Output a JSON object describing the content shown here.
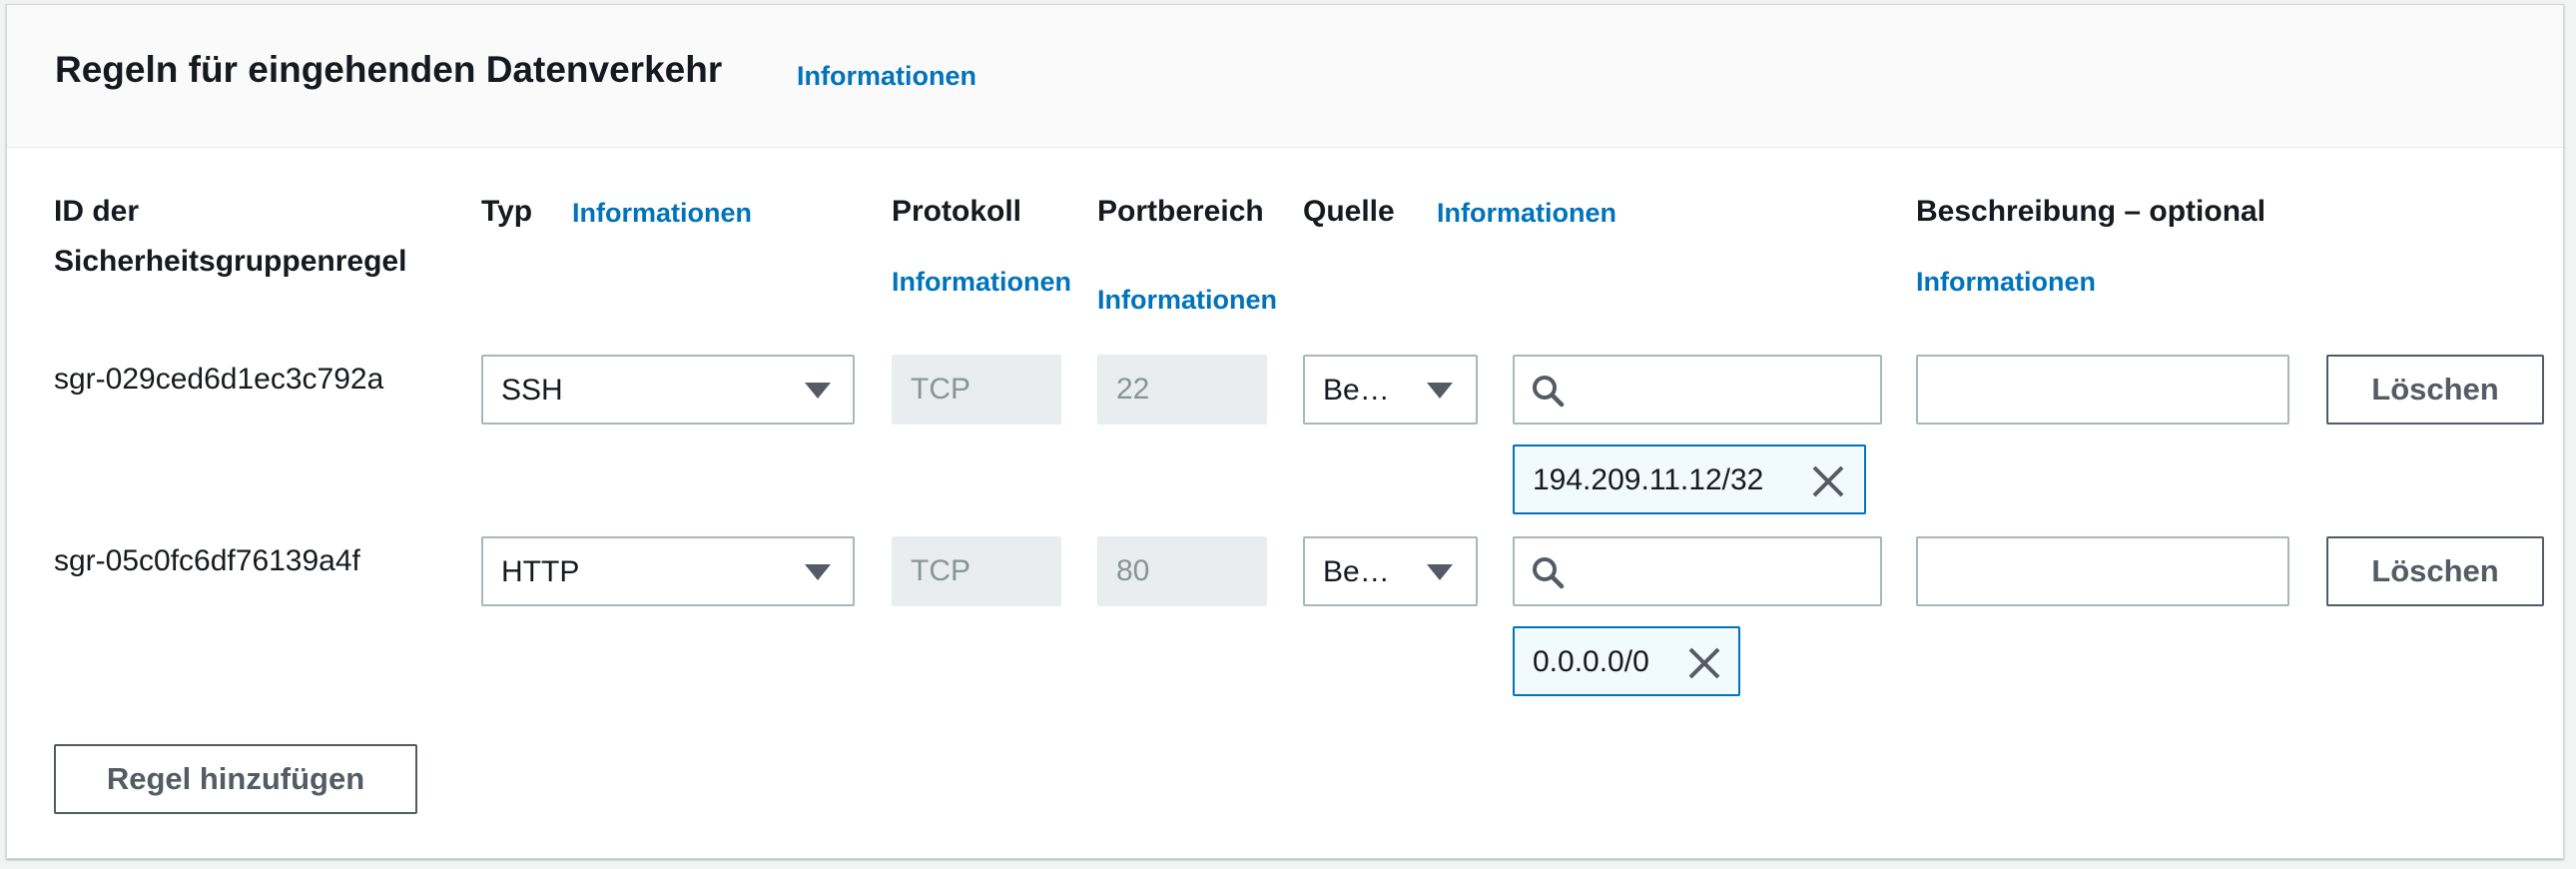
{
  "section": {
    "title": "Regeln für eingehenden Datenverkehr",
    "info": "Informationen"
  },
  "columns": {
    "id": "ID der Sicherheitsgruppenregel",
    "type": "Typ",
    "type_info": "Informationen",
    "protocol": "Protokoll",
    "protocol_info": "Informationen",
    "port": "Portbereich",
    "port_info": "Informationen",
    "source": "Quelle",
    "source_info": "Informationen",
    "description": "Beschreibung – optional",
    "description_info": "Informationen"
  },
  "rules": [
    {
      "id": "sgr-029ced6d1ec3c792a",
      "type": "SSH",
      "protocol": "TCP",
      "port": "22",
      "source_mode": "Be…",
      "search_value": "",
      "token": "194.209.11.12/32",
      "description": "",
      "delete_label": "Löschen"
    },
    {
      "id": "sgr-05c0fc6df76139a4f",
      "type": "HTTP",
      "protocol": "TCP",
      "port": "80",
      "source_mode": "Be…",
      "search_value": "",
      "token": "0.0.0.0/0",
      "description": "",
      "delete_label": "Löschen"
    }
  ],
  "add_rule_label": "Regel hinzufügen",
  "icons": {
    "search": "search-icon",
    "remove": "close-icon",
    "dropdown": "caret-down-icon"
  },
  "colors": {
    "link": "#0073bb",
    "token_bg": "#f1faff",
    "border": "#aab7b8",
    "disabled_bg": "#eaeded"
  }
}
